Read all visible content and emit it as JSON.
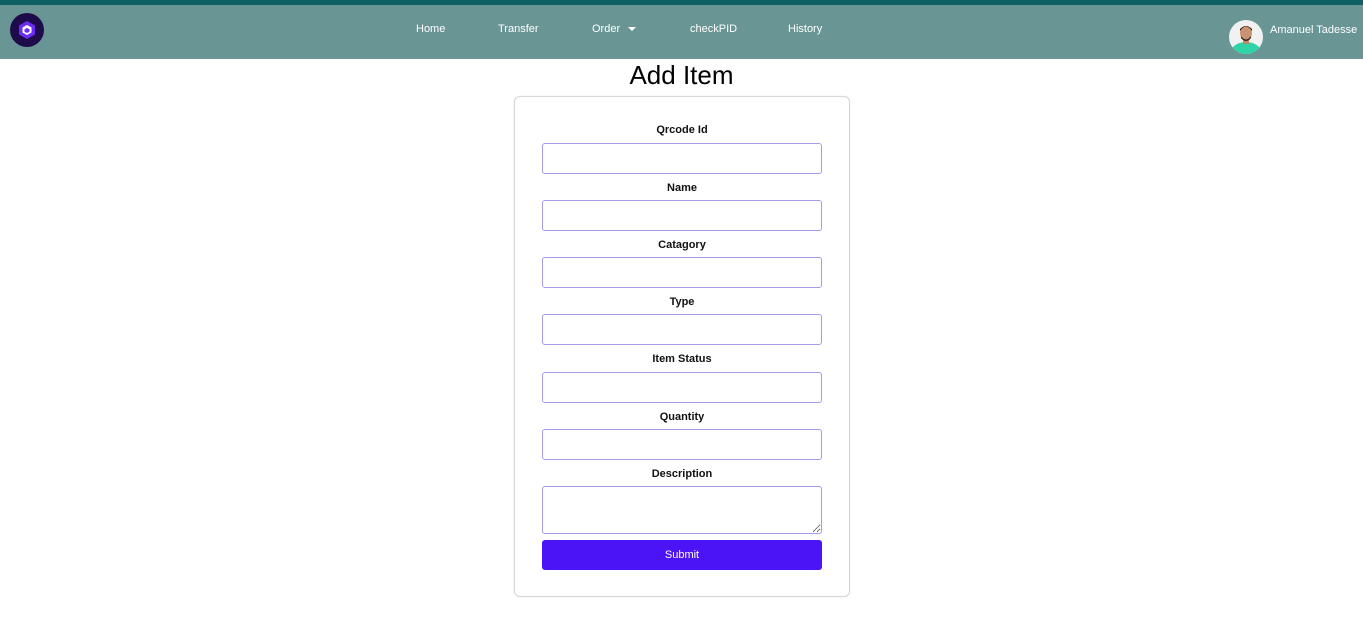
{
  "nav": {
    "logo_icon": "hexagon-cube-logo-icon",
    "links": [
      {
        "label": "Home"
      },
      {
        "label": "Transfer"
      },
      {
        "label": "Order",
        "has_dropdown": true
      },
      {
        "label": "checkPID"
      },
      {
        "label": "History"
      }
    ],
    "user_name": "Amanuel Tadesse"
  },
  "page": {
    "title": "Add Item"
  },
  "form": {
    "fields": [
      {
        "label": "Qrcode Id",
        "value": "",
        "placeholder": ""
      },
      {
        "label": "Name",
        "value": "",
        "placeholder": ""
      },
      {
        "label": "Catagory",
        "value": "",
        "placeholder": ""
      },
      {
        "label": "Type",
        "value": "",
        "placeholder": ""
      },
      {
        "label": "Item Status",
        "value": "",
        "placeholder": ""
      },
      {
        "label": "Quantity",
        "value": "",
        "placeholder": ""
      },
      {
        "label": "Description",
        "value": "",
        "placeholder": ""
      }
    ],
    "submit_label": "Submit"
  },
  "colors": {
    "navbar": "#699595",
    "topbar_stripe": "#0f5f63",
    "input_border": "#a79be6",
    "submit_button": "#4a14f7"
  }
}
